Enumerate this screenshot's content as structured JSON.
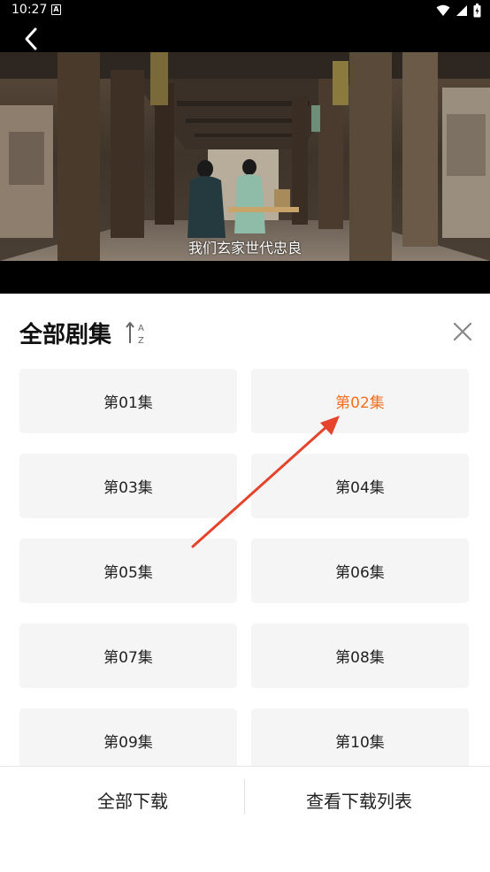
{
  "status_bar": {
    "time": "10:27",
    "notification_icon": "A",
    "icons": [
      "wifi-icon",
      "signal-icon",
      "battery-icon"
    ]
  },
  "video": {
    "subtitle": "我们玄家世代忠良"
  },
  "panel": {
    "title": "全部剧集",
    "sort_icon_glyphs": [
      "A",
      "Z"
    ],
    "episodes": [
      {
        "label": "第01集",
        "active": false
      },
      {
        "label": "第02集",
        "active": true
      },
      {
        "label": "第03集",
        "active": false
      },
      {
        "label": "第04集",
        "active": false
      },
      {
        "label": "第05集",
        "active": false
      },
      {
        "label": "第06集",
        "active": false
      },
      {
        "label": "第07集",
        "active": false
      },
      {
        "label": "第08集",
        "active": false
      },
      {
        "label": "第09集",
        "active": false
      },
      {
        "label": "第10集",
        "active": false
      }
    ]
  },
  "bottom": {
    "download_all": "全部下载",
    "view_download_list": "查看下载列表"
  },
  "colors": {
    "accent": "#f4701e",
    "arrow": "#e5432c",
    "tile_bg": "#f5f5f5"
  }
}
